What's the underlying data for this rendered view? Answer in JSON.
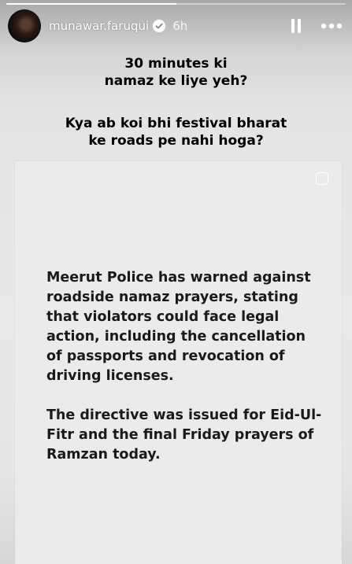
{
  "story": {
    "progress": 0.5
  },
  "header": {
    "username": "munawar.faruqui",
    "verified": true,
    "time": "6h"
  },
  "caption": {
    "line1": "30 minutes ki",
    "line2": "namaz ke liye yeh?",
    "line3": "Kya ab koi bhi festival bharat",
    "line4": "ke roads pe nahi hoga?"
  },
  "card": {
    "paragraph1": "Meerut Police has warned against roadside namaz prayers, stating that violators could face legal action, including the cancellation of passports and revocation of driving licenses.",
    "paragraph2": "The directive was issued for Eid-Ul-Fitr and the final Friday prayers of Ramzan today."
  },
  "icons": {
    "verified": "verified-badge-icon",
    "pause": "pause-icon",
    "more": "more-options-icon",
    "card_corner": "square-icon"
  }
}
